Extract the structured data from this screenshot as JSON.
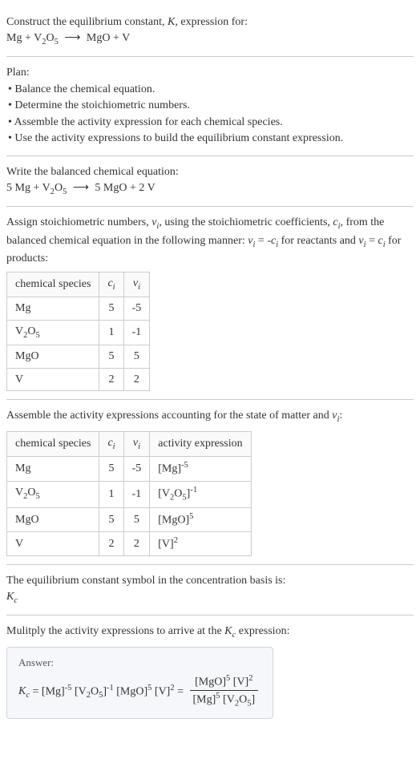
{
  "intro": {
    "line1": "Construct the equilibrium constant, K, expression for:",
    "equation": "Mg + V₂O₅  ⟶  MgO + V"
  },
  "plan": {
    "heading": "Plan:",
    "items": [
      "• Balance the chemical equation.",
      "• Determine the stoichiometric numbers.",
      "• Assemble the activity expression for each chemical species.",
      "• Use the activity expressions to build the equilibrium constant expression."
    ]
  },
  "balanced": {
    "heading": "Write the balanced chemical equation:",
    "equation": "5 Mg + V₂O₅  ⟶  5 MgO + 2 V"
  },
  "stoich_intro": {
    "text": "Assign stoichiometric numbers, νᵢ, using the stoichiometric coefficients, cᵢ, from the balanced chemical equation in the following manner: νᵢ = -cᵢ for reactants and νᵢ = cᵢ for products:"
  },
  "table1": {
    "headers": [
      "chemical species",
      "cᵢ",
      "νᵢ"
    ],
    "rows": [
      [
        "Mg",
        "5",
        "-5"
      ],
      [
        "V₂O₅",
        "1",
        "-1"
      ],
      [
        "MgO",
        "5",
        "5"
      ],
      [
        "V",
        "2",
        "2"
      ]
    ]
  },
  "activity_intro": "Assemble the activity expressions accounting for the state of matter and νᵢ:",
  "table2": {
    "headers": [
      "chemical species",
      "cᵢ",
      "νᵢ",
      "activity expression"
    ],
    "rows": [
      [
        "Mg",
        "5",
        "-5",
        "[Mg]⁻⁵"
      ],
      [
        "V₂O₅",
        "1",
        "-1",
        "[V₂O₅]⁻¹"
      ],
      [
        "MgO",
        "5",
        "5",
        "[MgO]⁵"
      ],
      [
        "V",
        "2",
        "2",
        "[V]²"
      ]
    ]
  },
  "symbol_intro": "The equilibrium constant symbol in the concentration basis is:",
  "symbol": "K𝒸",
  "multiply_intro": "Mulitply the activity expressions to arrive at the K𝒸 expression:",
  "answer": {
    "label": "Answer:",
    "lhs": "K𝒸 = [Mg]⁻⁵ [V₂O₅]⁻¹ [MgO]⁵ [V]² = ",
    "num": "[MgO]⁵ [V]²",
    "den": "[Mg]⁵ [V₂O₅]"
  }
}
